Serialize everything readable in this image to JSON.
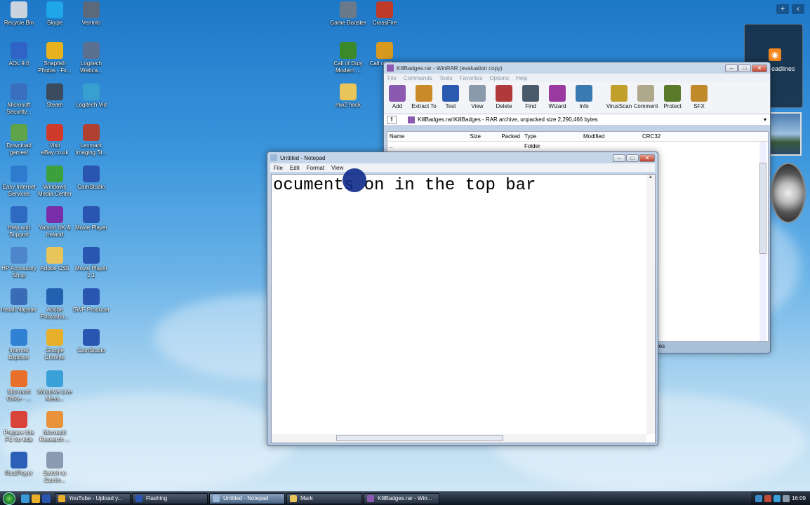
{
  "desktop": {
    "icons_left": [
      {
        "label": "Recycle Bin",
        "icon": "recycle-bin-icon",
        "color": "#c9d4df"
      },
      {
        "label": "AOL 9.0",
        "icon": "aol-icon",
        "color": "#2f63c5"
      },
      {
        "label": "Microsoft Security...",
        "icon": "security-icon",
        "color": "#3a6fc0"
      },
      {
        "label": "Download games!",
        "icon": "games-icon",
        "color": "#5fa34a"
      },
      {
        "label": "Easy Internet Services",
        "icon": "internet-services-icon",
        "color": "#2e7bd0"
      },
      {
        "label": "Help and Support",
        "icon": "help-icon",
        "color": "#2f6ac2"
      },
      {
        "label": "HP Accessory Shop",
        "icon": "hp-shop-icon",
        "color": "#4e86cc"
      },
      {
        "label": "Install Napster",
        "icon": "napster-icon",
        "color": "#3a6cb5"
      },
      {
        "label": "Internet Explorer",
        "icon": "ie-icon",
        "color": "#2f81d4"
      },
      {
        "label": "Microsoft Office - ...",
        "icon": "office-icon",
        "color": "#e8702a"
      },
      {
        "label": "Prepare this PC for kids",
        "icon": "kids-icon",
        "color": "#d8433a"
      },
      {
        "label": "RealPlayer",
        "icon": "realplayer-icon",
        "color": "#2b5fb8"
      }
    ],
    "icons_col2": [
      {
        "label": "Skype",
        "icon": "skype-icon",
        "color": "#1ea6e8"
      },
      {
        "label": "Snapfish Photos - Fir...",
        "icon": "snapfish-icon",
        "color": "#e8b21e"
      },
      {
        "label": "Steam",
        "icon": "steam-icon",
        "color": "#3b4a5c"
      },
      {
        "label": "Visit eBay.co.uk",
        "icon": "ebay-icon",
        "color": "#d03a2b"
      },
      {
        "label": "Windows Media Center",
        "icon": "media-center-icon",
        "color": "#3ca03c"
      },
      {
        "label": "Yahoo! UK & Ireland",
        "icon": "yahoo-icon",
        "color": "#7a2da8"
      },
      {
        "label": "Adobe CS5",
        "icon": "folder-icon",
        "color": "#e8c45a"
      },
      {
        "label": "Adobe Photosho...",
        "icon": "photoshop-icon",
        "color": "#2260b0"
      },
      {
        "label": "Google Chrome",
        "icon": "chrome-icon",
        "color": "#e8b02a"
      },
      {
        "label": "Windows Live Mess...",
        "icon": "messenger-icon",
        "color": "#3aa0d8"
      },
      {
        "label": "Microsoft Research ...",
        "icon": "research-icon",
        "color": "#e8923a"
      },
      {
        "label": "Switch to Gamin...",
        "icon": "gaming-icon",
        "color": "#8a9ab0"
      }
    ],
    "icons_col3": [
      {
        "label": "Ventrilo",
        "icon": "ventrilo-icon",
        "color": "#5a6a7a"
      },
      {
        "label": "Logitech Webca...",
        "icon": "webcam-icon",
        "color": "#5a7090"
      },
      {
        "label": "Logitech Vid",
        "icon": "logitech-vid-icon",
        "color": "#38a0d0"
      },
      {
        "label": "Lexmark Imaging St...",
        "icon": "lexmark-icon",
        "color": "#b04030"
      },
      {
        "label": "CamStudio",
        "icon": "camstudio-icon",
        "color": "#2a55b0"
      },
      {
        "label": "Movie Player",
        "icon": "movie-player-icon",
        "color": "#2a55b0"
      },
      {
        "label": "Movie Player 2.1",
        "icon": "movie-player-2-icon",
        "color": "#2a55b0"
      },
      {
        "label": "SWF Producer",
        "icon": "swf-icon",
        "color": "#2a55b0"
      },
      {
        "label": "CamStudio",
        "icon": "camstudio-2-icon",
        "color": "#2a55b0"
      }
    ],
    "icons_mid": [
      {
        "label": "Game Booster",
        "icon": "game-booster-icon",
        "color": "#6a7a8a"
      },
      {
        "label": "Call of Duty Modern ...",
        "icon": "cod-icon",
        "color": "#3a8a2a"
      },
      {
        "label": "mw2 hack",
        "icon": "folder-icon",
        "color": "#e8c45a"
      }
    ],
    "icons_mid2": [
      {
        "label": "CrossFire",
        "icon": "crossfire-icon",
        "color": "#c03a2a"
      },
      {
        "label": "Call of Mo...",
        "icon": "cod2-icon",
        "color": "#d89a1e"
      }
    ],
    "gadget_feed_label": "eadlines"
  },
  "winrar": {
    "title": "KillBadges.rar - WinRAR (evaluation copy)",
    "menu": [
      "File",
      "Commands",
      "Tools",
      "Favorites",
      "Options",
      "Help"
    ],
    "toolbar": [
      {
        "label": "Add",
        "icon": "add-archive-icon",
        "color": "#8a5ab0"
      },
      {
        "label": "Extract To",
        "icon": "extract-icon",
        "color": "#c98a2a"
      },
      {
        "label": "Test",
        "icon": "test-icon",
        "color": "#2a5ab0"
      },
      {
        "label": "View",
        "icon": "view-icon",
        "color": "#8a9aaa"
      },
      {
        "label": "Delete",
        "icon": "delete-icon",
        "color": "#b03a3a"
      },
      {
        "label": "Find",
        "icon": "find-icon",
        "color": "#4a5a6a"
      },
      {
        "label": "Wizard",
        "icon": "wizard-icon",
        "color": "#9a3aa0"
      },
      {
        "label": "Info",
        "icon": "info-icon",
        "color": "#3a7ab0"
      },
      {
        "label": "VirusScan",
        "icon": "virusscan-icon",
        "color": "#c0a02a"
      },
      {
        "label": "Comment",
        "icon": "comment-icon",
        "color": "#b0a88a"
      },
      {
        "label": "Protect",
        "icon": "protect-icon",
        "color": "#5a7a2a"
      },
      {
        "label": "SFX",
        "icon": "sfx-icon",
        "color": "#c08a2a"
      }
    ],
    "path": "KillBadges.rar\\KillBadges - RAR archive, unpacked size 2,290,466 bytes",
    "columns": [
      "Name",
      "Size",
      "Packed",
      "Type",
      "Modified",
      "CRC32"
    ],
    "rows": [
      {
        "name": "..",
        "size": "",
        "packed": "",
        "type": "Folder",
        "modified": "",
        "crc": ""
      }
    ],
    "status": "les"
  },
  "notepad": {
    "title": "Untitled - Notepad",
    "menu": [
      "File",
      "Edit",
      "Format",
      "View"
    ],
    "content": "ocuments on in the top bar"
  },
  "taskbar": {
    "tasks": [
      {
        "label": "YouTube - Upload y...",
        "icon": "chrome-task-icon",
        "color": "#e8b02a",
        "active": false
      },
      {
        "label": "Flashing",
        "icon": "camstudio-task-icon",
        "color": "#2a55b0",
        "active": false
      },
      {
        "label": "Untitled - Notepad",
        "icon": "notepad-task-icon",
        "color": "#9ab8d8",
        "active": true
      },
      {
        "label": "Mark",
        "icon": "folder-task-icon",
        "color": "#e8c45a",
        "active": false
      },
      {
        "label": "KillBadges.rar - Win...",
        "icon": "winrar-task-icon",
        "color": "#8a5ab0",
        "active": false
      }
    ],
    "clock": "16:09"
  }
}
